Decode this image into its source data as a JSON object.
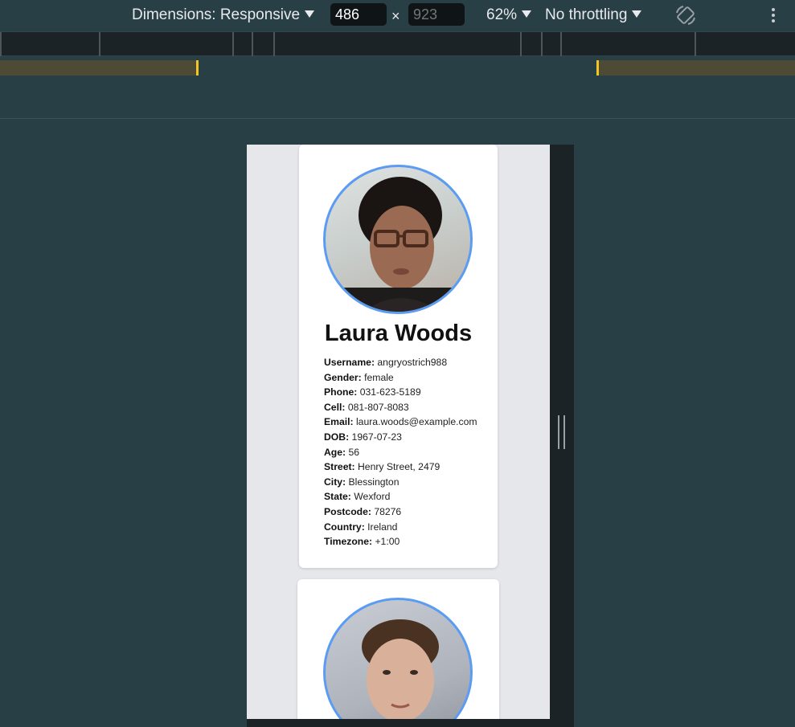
{
  "toolbar": {
    "dimensions_label": "Dimensions: Responsive",
    "width_value": "486",
    "times": "×",
    "height_placeholder": "923",
    "zoom": "62%",
    "throttling": "No throttling",
    "rotate_icon": "rotate-icon",
    "more_icon": "kebab-menu-icon"
  },
  "colors": {
    "panel_bg": "#283f45",
    "ruler_bg": "#1b2326",
    "media_marker": "#f3c522",
    "avatar_border": "#5b9cf2",
    "device_bg": "#e5e7eb",
    "card_bg": "#ffffff"
  },
  "profiles": [
    {
      "name": "Laura Woods",
      "fields": [
        {
          "label": "Username:",
          "value": "angryostrich988"
        },
        {
          "label": "Gender:",
          "value": "female"
        },
        {
          "label": "Phone:",
          "value": "031-623-5189"
        },
        {
          "label": "Cell:",
          "value": "081-807-8083"
        },
        {
          "label": "Email:",
          "value": "laura.woods@example.com"
        },
        {
          "label": "DOB:",
          "value": "1967-07-23"
        },
        {
          "label": "Age:",
          "value": "56"
        },
        {
          "label": "Street:",
          "value": "Henry Street, 2479"
        },
        {
          "label": "City:",
          "value": "Blessington"
        },
        {
          "label": "State:",
          "value": "Wexford"
        },
        {
          "label": "Postcode:",
          "value": "78276"
        },
        {
          "label": "Country:",
          "value": "Ireland"
        },
        {
          "label": "Timezone:",
          "value": "+1:00"
        }
      ]
    }
  ]
}
